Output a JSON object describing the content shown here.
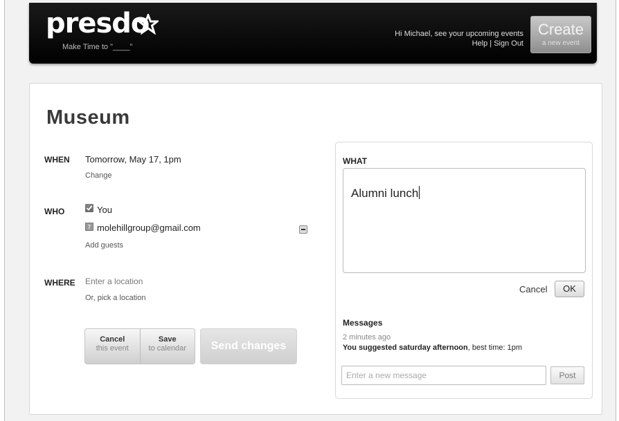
{
  "header": {
    "logo": "presdo",
    "tagline": "Make Time to \"____\"",
    "greeting": "Hi Michael, see your upcoming events",
    "help_link": "Help",
    "sign_out_link": "Sign Out",
    "create_label": "Create",
    "create_sub": "a new event"
  },
  "event": {
    "title": "Museum",
    "when": {
      "label": "WHEN",
      "value": "Tomorrow, May 17, 1pm",
      "change_link": "Change"
    },
    "who": {
      "label": "WHO",
      "guests": [
        {
          "name": "You",
          "checked": true
        },
        {
          "name": "molehillgroup@gmail.com",
          "checked": false
        }
      ],
      "add_guests_link": "Add guests"
    },
    "where": {
      "label": "WHERE",
      "placeholder": "Enter a location",
      "pick_link": "Or, pick a location"
    },
    "actions": {
      "cancel_main": "Cancel",
      "cancel_sub": "this event",
      "save_main": "Save",
      "save_sub": "to calendar",
      "send_label": "Send changes"
    }
  },
  "what_panel": {
    "label": "WHAT",
    "value": "Alumni lunch",
    "cancel_label": "Cancel",
    "ok_label": "OK",
    "messages_label": "Messages",
    "messages": [
      {
        "time": "2 minutes ago",
        "author": "You",
        "text_bold": "suggested saturday afternoon",
        "text_rest": ", best time: 1pm"
      }
    ],
    "message_placeholder": "Enter a new message",
    "post_label": "Post"
  }
}
